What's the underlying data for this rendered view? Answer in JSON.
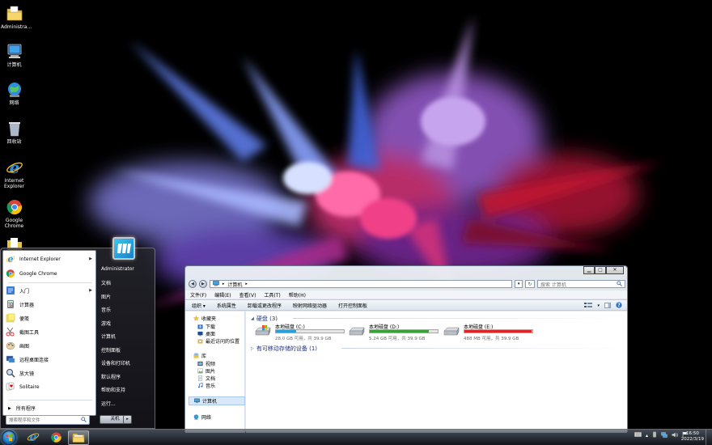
{
  "desktop": {
    "icons": [
      {
        "label": "Administra...",
        "icon": "folder-icon"
      },
      {
        "label": "计算机",
        "icon": "computer-icon"
      },
      {
        "label": "网络",
        "icon": "network-icon"
      },
      {
        "label": "回收站",
        "icon": "recycle-bin-icon"
      },
      {
        "label": "Internet Explorer",
        "icon": "ie-icon"
      },
      {
        "label": "Google Chrome",
        "icon": "chrome-icon"
      }
    ]
  },
  "start_menu": {
    "pinned": [
      {
        "label": "Internet Explorer",
        "has_arrow": true
      },
      {
        "label": "Google Chrome",
        "has_arrow": false
      }
    ],
    "recent": [
      {
        "label": "入门",
        "has_arrow": true
      },
      {
        "label": "计算器",
        "has_arrow": false
      },
      {
        "label": "便笺",
        "has_arrow": false
      },
      {
        "label": "截图工具",
        "has_arrow": false
      },
      {
        "label": "画图",
        "has_arrow": false
      },
      {
        "label": "远程桌面连接",
        "has_arrow": false
      },
      {
        "label": "放大镜",
        "has_arrow": false
      },
      {
        "label": "Solitaire",
        "has_arrow": false
      }
    ],
    "all_programs": "所有程序",
    "search_placeholder": "搜索程序和文件",
    "right": [
      "Administrator",
      "文档",
      "图片",
      "音乐",
      "游戏",
      "计算机",
      "控制面板",
      "设备和打印机",
      "默认程序",
      "帮助和支持",
      "运行..."
    ],
    "shutdown": "关机"
  },
  "explorer": {
    "address": "计算机",
    "search_placeholder": "搜索 计算机",
    "menu": [
      "文件(F)",
      "编辑(E)",
      "查看(V)",
      "工具(T)",
      "帮助(H)"
    ],
    "toolbar": [
      "组织 ▾",
      "系统属性",
      "卸载或更改程序",
      "映射网络驱动器",
      "打开控制面板"
    ],
    "nav": {
      "favorites": "收藏夹",
      "favorites_items": [
        "下载",
        "桌面",
        "最近访问的位置"
      ],
      "library": "库",
      "library_items": [
        "视频",
        "图片",
        "文档",
        "音乐"
      ],
      "computer": "计算机",
      "network": "网络"
    },
    "groups": {
      "hdd": "硬盘 (3)",
      "removable": "有可移动存储的设备 (1)"
    },
    "drives": [
      {
        "name": "本地磁盘 (C:)",
        "info": "28.0 GB 可用，共 39.9 GB",
        "used": 0.3,
        "color": "#26a0da"
      },
      {
        "name": "本地磁盘 (D:)",
        "info": "5.24 GB 可用，共 39.9 GB",
        "used": 0.87,
        "color": "#3aa13a"
      },
      {
        "name": "本地磁盘 (E:)",
        "info": "488 MB 可用，共 39.9 GB",
        "used": 0.99,
        "color": "#da2626"
      }
    ]
  },
  "taskbar": {
    "pinned": [
      "ie-icon",
      "chrome-icon",
      "explorer-icon"
    ],
    "clock_time": "16:50",
    "clock_date": "2022/3/19"
  }
}
